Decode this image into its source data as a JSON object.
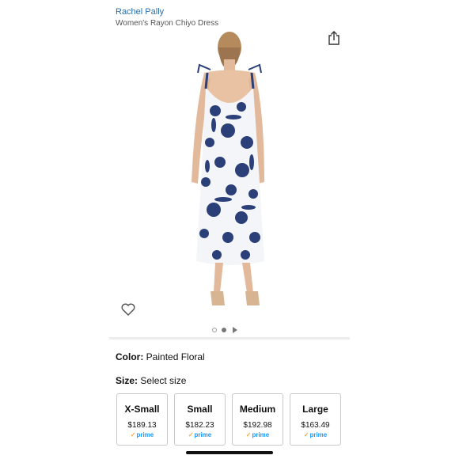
{
  "product": {
    "brand": "Rachel Pally",
    "title": "Women's Rayon Chiyo Dress"
  },
  "icons": {
    "share": "share-icon",
    "favorite": "heart-icon",
    "image_pager": [
      "dot-inactive",
      "dot-active",
      "play-triangle-icon"
    ]
  },
  "color": {
    "label": "Color:",
    "value": "Painted Floral"
  },
  "size": {
    "label": "Size:",
    "value": "Select size",
    "options": [
      {
        "name": "X-Small",
        "price": "$189.13",
        "badge": "prime"
      },
      {
        "name": "Small",
        "price": "$182.23",
        "badge": "prime"
      },
      {
        "name": "Medium",
        "price": "$192.98",
        "badge": "prime"
      },
      {
        "name": "Large",
        "price": "$163.49",
        "badge": "prime"
      }
    ]
  },
  "colors": {
    "brand_link": "#2a6fa8",
    "prime_blue": "#1a98ff",
    "dress_navy": "#2b3f78"
  }
}
